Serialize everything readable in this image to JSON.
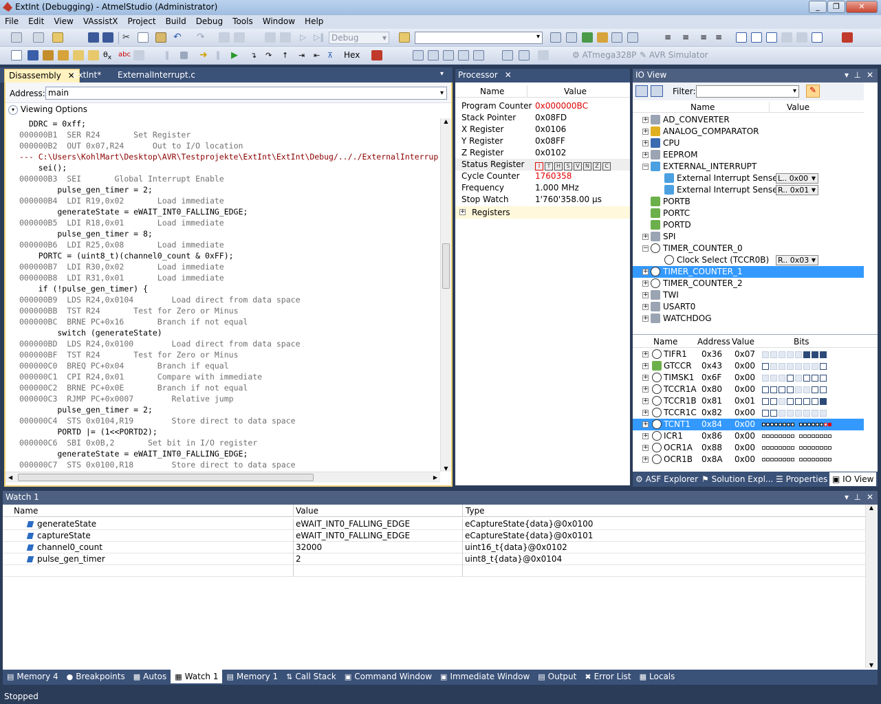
{
  "window": {
    "title": "ExtInt (Debugging) - AtmelStudio (Administrator)"
  },
  "menu": [
    "File",
    "Edit",
    "View",
    "VAssistX",
    "Project",
    "Build",
    "Debug",
    "Tools",
    "Window",
    "Help"
  ],
  "toolbar": {
    "config": "Debug",
    "hex": "Hex",
    "device": "ATmega328P",
    "tool": "AVR Simulator"
  },
  "doc_tabs": [
    {
      "label": "Disassembly"
    },
    {
      "label": "ExtInt*"
    },
    {
      "label": "ExternalInterrupt.c"
    }
  ],
  "disasm": {
    "address_label": "Address:",
    "address_value": "main",
    "viewing_options": "Viewing Options",
    "lines": [
      {
        "t": "src",
        "text": "  DDRC = 0xff;"
      },
      {
        "t": "asm",
        "addr": "000000B1",
        "text": "  SER R24       Set Register"
      },
      {
        "t": "asm",
        "addr": "000000B2",
        "text": "  OUT 0x07,R24      Out to I/O location"
      },
      {
        "t": "path",
        "text": "--- C:\\Users\\KohlMart\\Desktop\\AVR\\Testprojekte\\ExtInt\\ExtInt\\Debug/.././ExternalInterrup"
      },
      {
        "t": "src",
        "text": "    sei();"
      },
      {
        "t": "asm",
        "addr": "000000B3",
        "text": "  SEI       Global Interrupt Enable"
      },
      {
        "t": "src",
        "text": "        pulse_gen_timer = 2;"
      },
      {
        "t": "asm",
        "addr": "000000B4",
        "text": "  LDI R19,0x02       Load immediate"
      },
      {
        "t": "src",
        "text": "        generateState = eWAIT_INT0_FALLING_EDGE;"
      },
      {
        "t": "asm",
        "addr": "000000B5",
        "text": "  LDI R18,0x01       Load immediate",
        "bp": true
      },
      {
        "t": "src",
        "text": "        pulse_gen_timer = 8;"
      },
      {
        "t": "asm",
        "addr": "000000B6",
        "text": "  LDI R25,0x08       Load immediate"
      },
      {
        "t": "src",
        "text": "    PORTC = (uint8_t)(channel0_count & 0xFF);"
      },
      {
        "t": "asm",
        "addr": "000000B7",
        "text": "  LDI R30,0x02       Load immediate"
      },
      {
        "t": "asm",
        "addr": "000000B8",
        "text": "  LDI R31,0x01       Load immediate"
      },
      {
        "t": "src",
        "text": "    if (!pulse_gen_timer) {"
      },
      {
        "t": "asm",
        "addr": "000000B9",
        "text": "  LDS R24,0x0104        Load direct from data space"
      },
      {
        "t": "asm",
        "addr": "000000BB",
        "text": "  TST R24       Test for Zero or Minus"
      },
      {
        "t": "asm",
        "addr": "000000BC",
        "text": "  BRNE PC+0x16       Branch if not equal",
        "cur": true
      },
      {
        "t": "src",
        "text": "        switch (generateState)"
      },
      {
        "t": "asm",
        "addr": "000000BD",
        "text": "  LDS R24,0x0100        Load direct from data space",
        "bp": true
      },
      {
        "t": "asm",
        "addr": "000000BF",
        "text": "  TST R24       Test for Zero or Minus"
      },
      {
        "t": "asm",
        "addr": "000000C0",
        "text": "  BREQ PC+0x04       Branch if equal"
      },
      {
        "t": "asm",
        "addr": "000000C1",
        "text": "  CPI R24,0x01       Compare with immediate"
      },
      {
        "t": "asm",
        "addr": "000000C2",
        "text": "  BRNE PC+0x0E       Branch if not equal"
      },
      {
        "t": "asm",
        "addr": "000000C3",
        "text": "  RJMP PC+0x0007        Relative jump"
      },
      {
        "t": "src",
        "text": "        pulse_gen_timer = 2;"
      },
      {
        "t": "asm",
        "addr": "000000C4",
        "text": "  STS 0x0104,R19        Store direct to data space"
      },
      {
        "t": "src",
        "text": "        PORTD |= (1<<PORTD2);"
      },
      {
        "t": "asm",
        "addr": "000000C6",
        "text": "  SBI 0x0B,2       Set bit in I/O register"
      },
      {
        "t": "src",
        "text": "        generateState = eWAIT_INT0_FALLING_EDGE;"
      },
      {
        "t": "asm",
        "addr": "000000C7",
        "text": "  STS 0x0100,R18        Store direct to data space"
      }
    ]
  },
  "processor": {
    "title": "Processor",
    "col_name": "Name",
    "col_value": "Value",
    "rows": [
      {
        "name": "Program Counter",
        "value": "0x000000BC",
        "red": true
      },
      {
        "name": "Stack Pointer",
        "value": "0x08FD"
      },
      {
        "name": "X Register",
        "value": "0x0106"
      },
      {
        "name": "Y Register",
        "value": "0x08FF"
      },
      {
        "name": "Z Register",
        "value": "0x0102"
      },
      {
        "name": "Status Register",
        "value": "",
        "flags": [
          "I",
          "T",
          "H",
          "S",
          "V",
          "N",
          "Z",
          "C"
        ]
      },
      {
        "name": "Cycle Counter",
        "value": "1760358",
        "red": true
      },
      {
        "name": "Frequency",
        "value": "1.000 MHz"
      },
      {
        "name": "Stop Watch",
        "value": "1'760'358.00 µs"
      }
    ],
    "registers_label": "Registers"
  },
  "ioview": {
    "title": "IO View",
    "filter_label": "Filter:",
    "col_name": "Name",
    "col_value": "Value",
    "tree": [
      {
        "label": "AD_CONVERTER",
        "exp": "+",
        "icon": "chip"
      },
      {
        "label": "ANALOG_COMPARATOR",
        "exp": "+",
        "icon": "adc"
      },
      {
        "label": "CPU",
        "exp": "+",
        "icon": "cpu"
      },
      {
        "label": "EEPROM",
        "exp": "+",
        "icon": "chip"
      },
      {
        "label": "EXTERNAL_INTERRUPT",
        "exp": "-",
        "icon": "int"
      },
      {
        "label": "External Interrupt Sense...",
        "child": true,
        "icon": "int",
        "dd": "L.. 0x00"
      },
      {
        "label": "External Interrupt Sense...",
        "child": true,
        "icon": "int",
        "dd": "R.. 0x01"
      },
      {
        "label": "PORTB",
        "exp": "",
        "icon": "io"
      },
      {
        "label": "PORTC",
        "exp": "",
        "icon": "io"
      },
      {
        "label": "PORTD",
        "exp": "",
        "icon": "io"
      },
      {
        "label": "SPI",
        "exp": "+",
        "icon": "chip"
      },
      {
        "label": "TIMER_COUNTER_0",
        "exp": "-",
        "icon": "clock"
      },
      {
        "label": "Clock Select (TCCR0B)",
        "child": true,
        "icon": "clock",
        "dd": "R.. 0x03"
      },
      {
        "label": "TIMER_COUNTER_1",
        "exp": "+",
        "icon": "clock",
        "sel": true
      },
      {
        "label": "TIMER_COUNTER_2",
        "exp": "+",
        "icon": "clock"
      },
      {
        "label": "TWI",
        "exp": "+",
        "icon": "chip"
      },
      {
        "label": "USART0",
        "exp": "+",
        "icon": "chip"
      },
      {
        "label": "WATCHDOG",
        "exp": "+",
        "icon": "chip"
      }
    ],
    "reg_cols": {
      "name": "Name",
      "address": "Address",
      "value": "Value",
      "bits": "Bits"
    },
    "regs": [
      {
        "name": "TIFR1",
        "address": "0x36",
        "value": "0x07",
        "icon": "clock",
        "bits": "gggggggg"
      },
      {
        "name": "GTCCR",
        "address": "0x43",
        "value": "0x00",
        "icon": "io",
        "bits": "0gggggg0"
      },
      {
        "name": "TIMSK1",
        "address": "0x6F",
        "value": "0x00",
        "icon": "clock",
        "bits": "ggg0g000"
      },
      {
        "name": "TCCR1A",
        "address": "0x80",
        "value": "0x00",
        "icon": "clock",
        "bits": "0000gg00"
      },
      {
        "name": "TCCR1B",
        "address": "0x81",
        "value": "0x01",
        "icon": "clock",
        "bits": "00g00001"
      },
      {
        "name": "TCCR1C",
        "address": "0x82",
        "value": "0x00",
        "icon": "clock",
        "bits": "00gggggg"
      },
      {
        "name": "TCNT1",
        "address": "0x84",
        "value": "0x00",
        "icon": "clock",
        "sel": true,
        "small": true
      },
      {
        "name": "ICR1",
        "address": "0x86",
        "value": "0x00",
        "icon": "clock",
        "small": true
      },
      {
        "name": "OCR1A",
        "address": "0x88",
        "value": "0x00",
        "icon": "clock",
        "small": true
      },
      {
        "name": "OCR1B",
        "address": "0x8A",
        "value": "0x00",
        "icon": "clock",
        "small": true
      }
    ],
    "bottom_tabs": [
      "ASF Explorer",
      "Solution Expl...",
      "Properties",
      "IO View"
    ]
  },
  "watch": {
    "title": "Watch 1",
    "cols": {
      "name": "Name",
      "value": "Value",
      "type": "Type"
    },
    "rows": [
      {
        "name": "generateState",
        "value": "eWAIT_INT0_FALLING_EDGE",
        "type": "eCaptureState{data}@0x0100"
      },
      {
        "name": "captureState",
        "value": "eWAIT_INT0_FALLING_EDGE",
        "type": "eCaptureState{data}@0x0101"
      },
      {
        "name": "channel0_count",
        "value": "32000",
        "type": "uint16_t{data}@0x0102"
      },
      {
        "name": "pulse_gen_timer",
        "value": "2",
        "type": "uint8_t{data}@0x0104"
      }
    ]
  },
  "bottom_tabs": [
    "Memory 4",
    "Breakpoints",
    "Autos",
    "Watch 1",
    "Memory 1",
    "Call Stack",
    "Command Window",
    "Immediate Window",
    "Output",
    "Error List",
    "Locals"
  ],
  "status": {
    "text": "Stopped"
  }
}
